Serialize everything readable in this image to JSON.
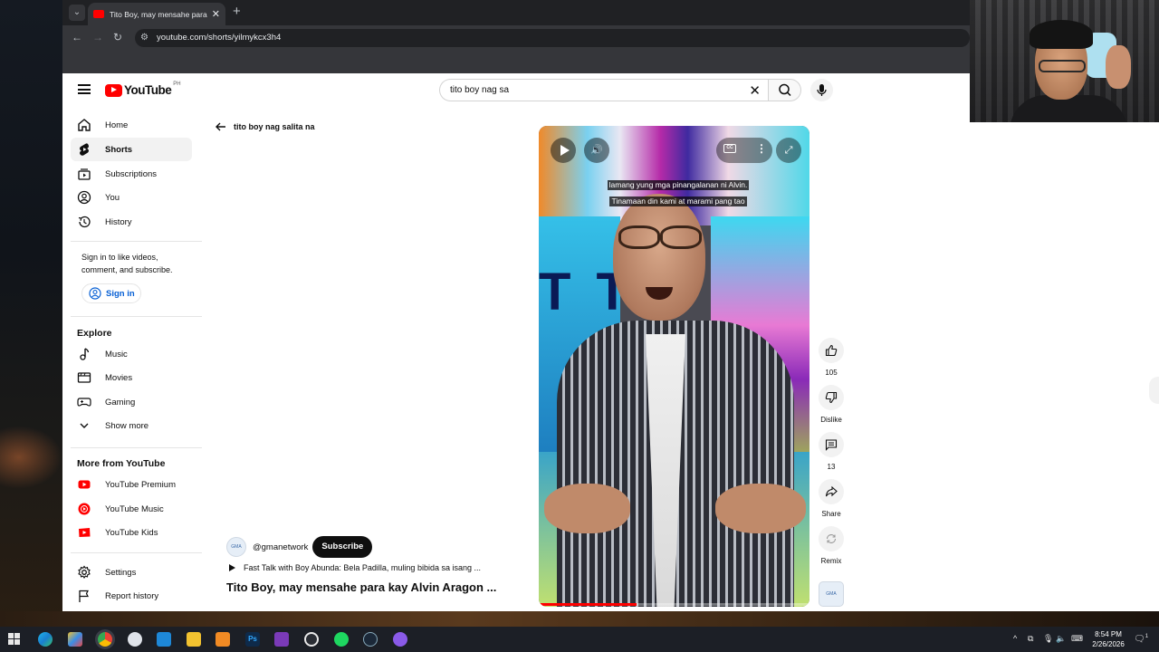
{
  "browser": {
    "tab_title": "Tito Boy, may mensahe para kay Alvin Aragon",
    "url": "youtube.com/shorts/yilmykcx3h4"
  },
  "header": {
    "logo_text": "YouTube",
    "region": "PH",
    "search_value": "tito boy nag sa"
  },
  "sidebar": {
    "items": [
      {
        "label": "Home",
        "icon": "home-icon"
      },
      {
        "label": "Shorts",
        "icon": "shorts-icon"
      },
      {
        "label": "Subscriptions",
        "icon": "subscriptions-icon"
      },
      {
        "label": "You",
        "icon": "you-icon"
      },
      {
        "label": "History",
        "icon": "history-icon"
      }
    ],
    "signin_prompt": "Sign in to like videos, comment, and subscribe.",
    "signin_label": "Sign in",
    "explore_title": "Explore",
    "explore": [
      {
        "label": "Music",
        "icon": "music-icon"
      },
      {
        "label": "Movies",
        "icon": "movies-icon"
      },
      {
        "label": "Gaming",
        "icon": "gaming-icon"
      },
      {
        "label": "Show more",
        "icon": "chevron-down-icon"
      }
    ],
    "more_title": "More from YouTube",
    "more": [
      {
        "label": "YouTube Premium",
        "icon": "youtube-premium-icon"
      },
      {
        "label": "YouTube Music",
        "icon": "youtube-music-icon"
      },
      {
        "label": "YouTube Kids",
        "icon": "youtube-kids-icon"
      }
    ],
    "bottom": [
      {
        "label": "Settings",
        "icon": "gear-icon"
      },
      {
        "label": "Report history",
        "icon": "flag-icon"
      }
    ]
  },
  "shorts": {
    "back_query": "tito boy nag salita na",
    "subtitle_line1": "lamang yung mga pinangalanan ni Alvin.",
    "subtitle_line2": "Tinamaan din kami at marami pang tao",
    "progress_fraction": 0.36,
    "channel_handle": "@gmanetwork",
    "channel_logo_text": "GMA",
    "subscribe_label": "Subscribe",
    "related_text": "Fast Talk with Boy Abunda: Bela Padilla, muling bibida sa isang ...",
    "video_title": "Tito Boy, may mensahe para kay Alvin Aragon ...",
    "actions": {
      "like_count": "105",
      "dislike_label": "Dislike",
      "comment_count": "13",
      "share_label": "Share",
      "remix_label": "Remix"
    }
  },
  "taskbar": {
    "time": "8:54 PM",
    "date": "2/26/2026",
    "notification_count": "1"
  },
  "colors": {
    "brand_red": "#ff0000",
    "link_blue": "#065fd4",
    "chrome_dark": "#202124"
  }
}
